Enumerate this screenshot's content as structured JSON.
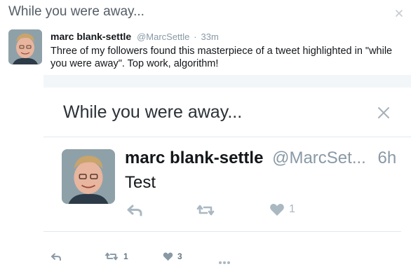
{
  "header": {
    "title": "While you were away...",
    "close_icon": "close-icon"
  },
  "tweet": {
    "name": "marc blank-settle",
    "handle": "@MarcSettle",
    "separator": "·",
    "time": "33m",
    "text": "Three of my followers found this masterpiece of a tweet highlighted in \"while you were away\". Top work, algorithm!",
    "actions": {
      "reply_icon": "reply-icon",
      "retweet_count": "1",
      "like_count": "3",
      "more_icon": "more-icon"
    }
  },
  "embedded": {
    "title": "While you were away...",
    "close_icon": "close-icon",
    "tweet": {
      "name": "marc blank-settle",
      "handle": "@MarcSet...",
      "time": "6h",
      "text": "Test",
      "like_count": "1"
    }
  },
  "colors": {
    "text": "#14171a",
    "muted": "#8899a6",
    "icon": "#aab8c2",
    "divider": "#e1e8ed"
  }
}
